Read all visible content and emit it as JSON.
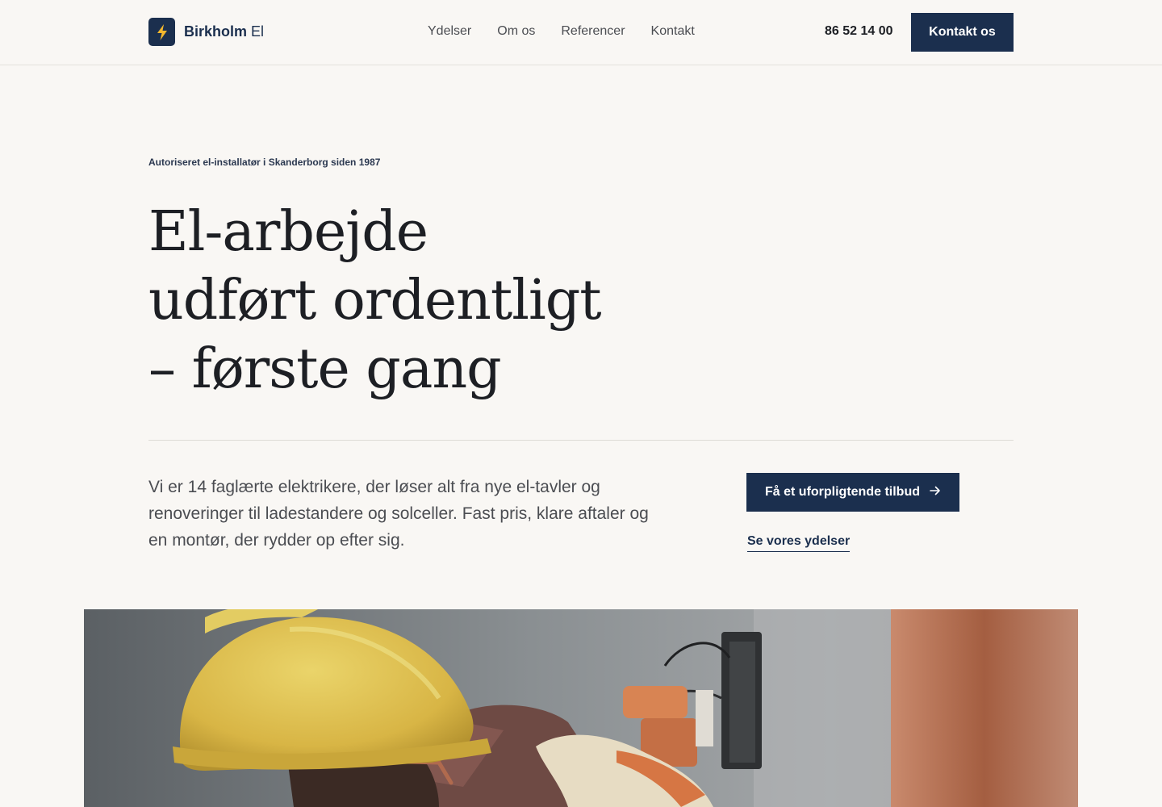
{
  "header": {
    "brand_name": "Birkholm",
    "brand_suffix": "El",
    "logo_icon": "lightning-bolt-icon",
    "nav": [
      {
        "label": "Ydelser"
      },
      {
        "label": "Om os"
      },
      {
        "label": "Referencer"
      },
      {
        "label": "Kontakt"
      }
    ],
    "phone": "86 52 14 00",
    "cta_label": "Kontakt os"
  },
  "hero": {
    "eyebrow": "Autoriseret el-installatør i Skanderborg siden 1987",
    "headline_line1": "El-arbejde",
    "headline_line2": "udført ordentligt",
    "headline_line3": "– første gang",
    "lead": "Vi er 14 faglærte elektrikere, der løser alt fra nye el-tavler og renoveringer til ladestandere og solceller. Fast pris, klare aftaler og en montør, der rydder op efter sig.",
    "primary_cta": "Få et uforpligtende tilbud",
    "primary_cta_icon": "arrow-right-icon",
    "secondary_link": "Se vores ydelser"
  },
  "colors": {
    "background": "#f9f7f4",
    "brand_navy": "#1b2f4e",
    "accent_yellow": "#f5b82e",
    "text_dark": "#1d1f24",
    "text_muted": "#4b4d52"
  }
}
